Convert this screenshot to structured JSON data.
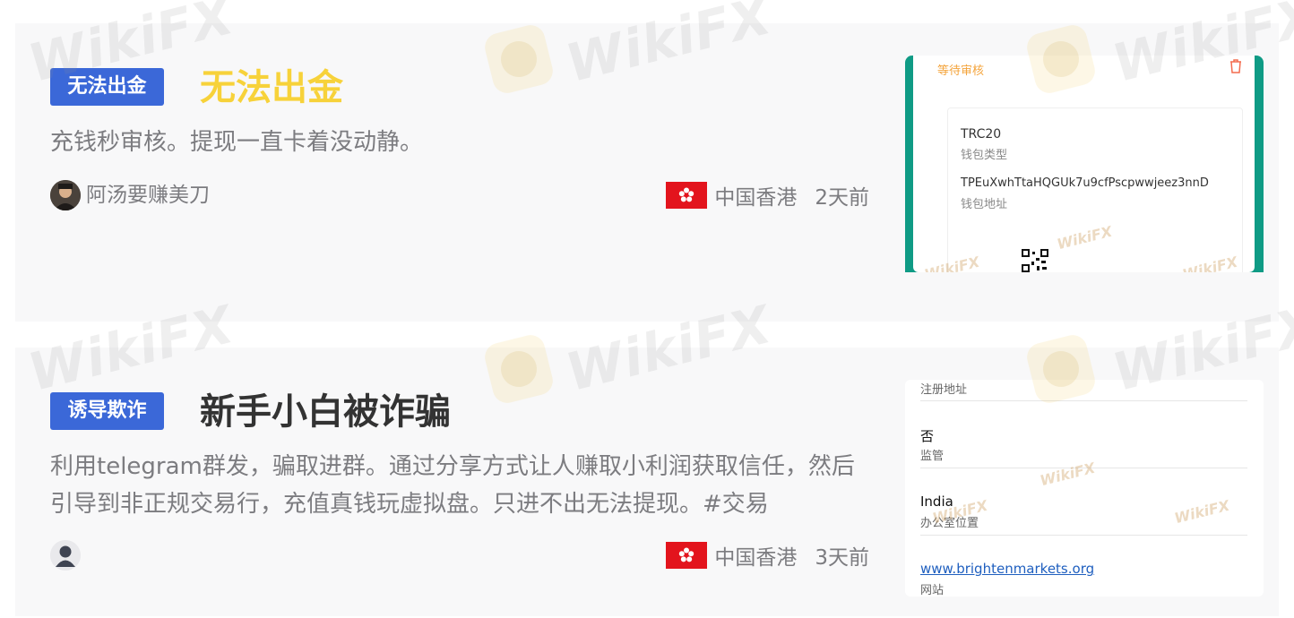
{
  "watermark": "WikiFX",
  "colors": {
    "tag_bg": "#3b68d8",
    "title1": "#f7d23a",
    "title2": "#333333",
    "meta": "#7c7c80",
    "thumb_accent": "#0f9b85",
    "flag": "#e3141d"
  },
  "cards": [
    {
      "tag": "无法出金",
      "title": "无法出金",
      "description": "充钱秒审核。提现一直卡着没动静。",
      "user": {
        "name": "阿汤要赚美刀",
        "avatar": "user-photo"
      },
      "region": "中国香港",
      "time": "2天前",
      "thumbnail": {
        "status": "等待审核",
        "rows": [
          {
            "value": "TRC20",
            "label": "钱包类型"
          },
          {
            "value": "TPEuXwhTtaHQGUk7u9cfPscpwwjeez3nnD",
            "label": "钱包地址"
          }
        ]
      }
    },
    {
      "tag": "诱导欺诈",
      "title": "新手小白被诈骗",
      "description": "利用telegram群发，骗取进群。通过分享方式让人赚取小利润获取信任，然后引导到非正规交易行，充值真钱玩虚拟盘。只进不出无法提现。#交易",
      "user": {
        "name": "",
        "avatar": "default-user"
      },
      "region": "中国香港",
      "time": "3天前",
      "thumbnail": {
        "rows": [
          {
            "value": "",
            "label": "注册地址"
          },
          {
            "value": "否",
            "label": "监管"
          },
          {
            "value": "India",
            "label": "办公室位置"
          },
          {
            "value": "www.brightenmarkets.org",
            "label": "网站"
          }
        ]
      }
    }
  ]
}
